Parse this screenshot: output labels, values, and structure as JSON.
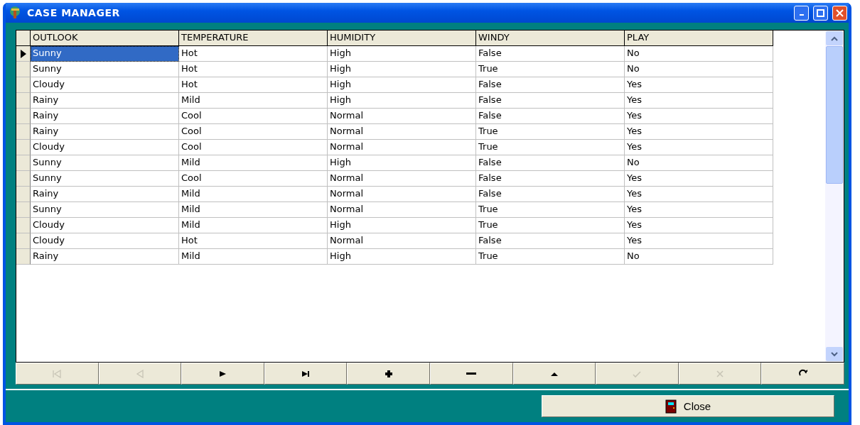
{
  "window": {
    "title": "CASE MANAGER"
  },
  "table": {
    "columns": [
      "OUTLOOK",
      "TEMPERATURE",
      "HUMIDITY",
      "WINDY",
      "PLAY"
    ],
    "rows": [
      {
        "cells": [
          "Sunny",
          "Hot",
          "High",
          "False",
          "No"
        ],
        "selected": true
      },
      {
        "cells": [
          "Sunny",
          "Hot",
          "High",
          "True",
          "No"
        ],
        "selected": false
      },
      {
        "cells": [
          "Cloudy",
          "Hot",
          "High",
          "False",
          "Yes"
        ],
        "selected": false
      },
      {
        "cells": [
          "Rainy",
          "Mild",
          "High",
          "False",
          "Yes"
        ],
        "selected": false
      },
      {
        "cells": [
          "Rainy",
          "Cool",
          "Normal",
          "False",
          "Yes"
        ],
        "selected": false
      },
      {
        "cells": [
          "Rainy",
          "Cool",
          "Normal",
          "True",
          "Yes"
        ],
        "selected": false
      },
      {
        "cells": [
          "Cloudy",
          "Cool",
          "Normal",
          "True",
          "Yes"
        ],
        "selected": false
      },
      {
        "cells": [
          "Sunny",
          "Mild",
          "High",
          "False",
          "No"
        ],
        "selected": false
      },
      {
        "cells": [
          "Sunny",
          "Cool",
          "Normal",
          "False",
          "Yes"
        ],
        "selected": false
      },
      {
        "cells": [
          "Rainy",
          "Mild",
          "Normal",
          "False",
          "Yes"
        ],
        "selected": false
      },
      {
        "cells": [
          "Sunny",
          "Mild",
          "Normal",
          "True",
          "Yes"
        ],
        "selected": false
      },
      {
        "cells": [
          "Cloudy",
          "Mild",
          "High",
          "True",
          "Yes"
        ],
        "selected": false
      },
      {
        "cells": [
          "Cloudy",
          "Hot",
          "Normal",
          "False",
          "Yes"
        ],
        "selected": false
      },
      {
        "cells": [
          "Rainy",
          "Mild",
          "High",
          "True",
          "No"
        ],
        "selected": false
      }
    ]
  },
  "navigator": [
    {
      "kind": "first",
      "disabled": true
    },
    {
      "kind": "prior",
      "disabled": true
    },
    {
      "kind": "next",
      "disabled": false
    },
    {
      "kind": "last",
      "disabled": false
    },
    {
      "kind": "insert",
      "disabled": false
    },
    {
      "kind": "delete",
      "disabled": false
    },
    {
      "kind": "edit",
      "disabled": false
    },
    {
      "kind": "post",
      "disabled": true
    },
    {
      "kind": "cancel",
      "disabled": true
    },
    {
      "kind": "refresh",
      "disabled": false
    }
  ],
  "close_button": {
    "label": "Close"
  }
}
